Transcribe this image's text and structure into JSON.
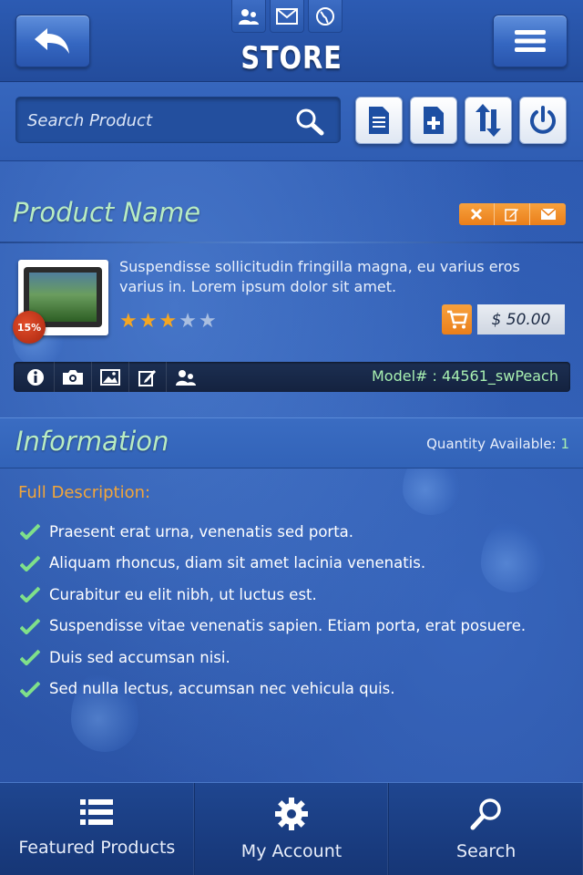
{
  "header": {
    "title": "STORE",
    "top_icons": [
      "users-icon",
      "mail-icon",
      "globe-icon"
    ]
  },
  "search": {
    "placeholder": "Search Product"
  },
  "toolbar": {
    "buttons": [
      "document-icon",
      "add-icon",
      "sort-icon",
      "power-icon"
    ]
  },
  "product": {
    "name": "Product Name",
    "description": "Suspendisse sollicitudin fringilla magna, eu varius eros varius in. Lorem ipsum dolor sit amet.",
    "discount": "15%",
    "rating": 3,
    "rating_max": 5,
    "price": "$ 50.00",
    "model": "Model# : 44561_swPeach"
  },
  "information": {
    "title": "Information",
    "quantity_label": "Quantity Available:",
    "quantity_value": "1",
    "full_description_label": "Full Description:",
    "bullets": [
      "Praesent erat urna, venenatis sed porta.",
      "Aliquam rhoncus, diam sit amet lacinia venenatis.",
      "Curabitur eu elit nibh, ut luctus est.",
      "Suspendisse vitae venenatis sapien. Etiam porta, erat  posuere.",
      "Duis sed accumsan nisi.",
      "Sed nulla lectus, accumsan nec vehicula quis."
    ]
  },
  "bottom_nav": {
    "items": [
      {
        "label": "Featured Products",
        "icon": "list-icon"
      },
      {
        "label": "My Account",
        "icon": "gear-icon"
      },
      {
        "label": "Search",
        "icon": "search-icon"
      }
    ]
  },
  "colors": {
    "accent_green": "#b8ecc3",
    "accent_orange": "#f3a63a",
    "background": "#2a55a8"
  }
}
